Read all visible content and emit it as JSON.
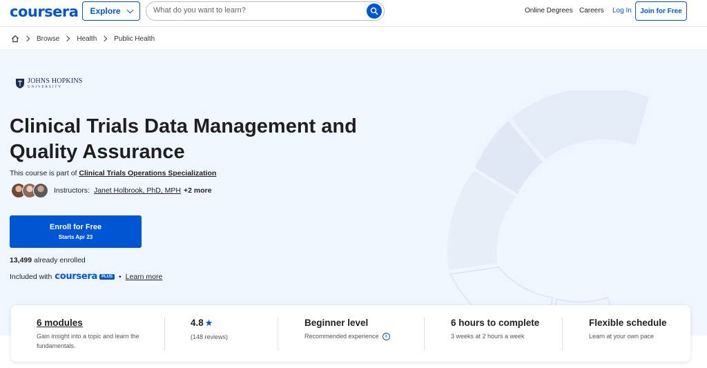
{
  "header": {
    "logo": "coursera",
    "explore_label": "Explore",
    "search_placeholder": "What do you want to learn?",
    "links": [
      "Online Degrees",
      "Careers",
      "Log In"
    ],
    "join_label": "Join for Free"
  },
  "breadcrumb": [
    "Browse",
    "Health",
    "Public Health"
  ],
  "hero": {
    "university_line1": "JOHNS HOPKINS",
    "university_line2": "UNIVERSITY",
    "title": "Clinical Trials Data Management and Quality Assurance",
    "spec_prefix": "This course is part of",
    "spec_link": "Clinical Trials Operations Specialization",
    "instructors_label": "Instructors:",
    "instructor_name": "Janet Holbrook, PhD, MPH",
    "instructors_more": "+2 more",
    "enroll_label": "Enroll for Free",
    "enroll_sub": "Starts Apr 23",
    "enrolled_count": "13,499",
    "enrolled_suffix": "already enrolled",
    "included_prefix": "Included with",
    "included_brand": "coursera",
    "included_plus": "PLUS",
    "learn_more": "Learn more"
  },
  "info": {
    "modules_title": "6 modules",
    "modules_sub": "Gain insight into a topic and learn the fundamentals.",
    "rating": "4.8",
    "reviews": "(148 reviews)",
    "level_title": "Beginner level",
    "level_sub": "Recommended experience",
    "hours_title": "6 hours to complete",
    "hours_sub": "3 weeks at 2 hours a week",
    "schedule_title": "Flexible schedule",
    "schedule_sub": "Learn at your own pace"
  },
  "colors": {
    "brand": "#0056d2",
    "hero_bg": "#f0f6ff"
  }
}
